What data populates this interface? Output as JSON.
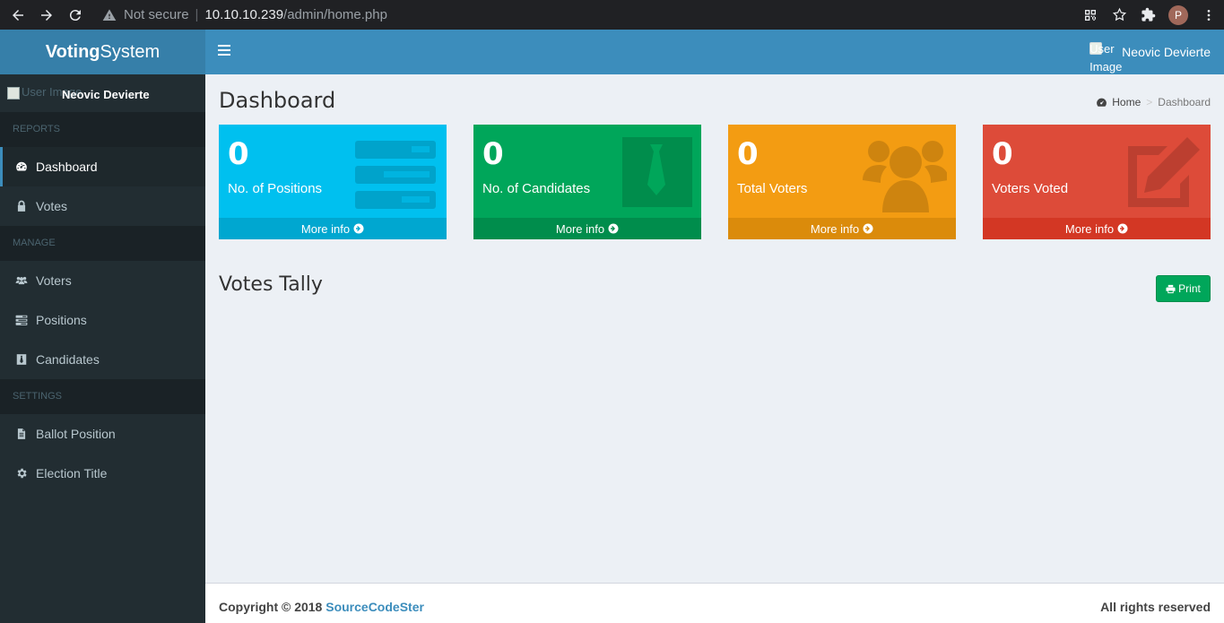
{
  "browser": {
    "not_secure": "Not secure",
    "url_host": "10.10.10.239",
    "url_path": "/admin/home.php",
    "profile_initial": "P"
  },
  "app": {
    "logo_bold": "Voting",
    "logo_rest": "System",
    "top_user_image_alt": "User Image",
    "top_user_name": "Neovic Devierte"
  },
  "sidebar": {
    "user_image_alt": "User Image",
    "user_name": "Neovic Devierte",
    "sections": [
      {
        "header": "REPORTS",
        "items": [
          {
            "label": "Dashboard",
            "icon": "dashboard-icon"
          },
          {
            "label": "Votes",
            "icon": "lock-icon"
          }
        ]
      },
      {
        "header": "MANAGE",
        "items": [
          {
            "label": "Voters",
            "icon": "users-icon"
          },
          {
            "label": "Positions",
            "icon": "tasks-icon"
          },
          {
            "label": "Candidates",
            "icon": "black-tie-icon"
          }
        ]
      },
      {
        "header": "SETTINGS",
        "items": [
          {
            "label": "Ballot Position",
            "icon": "file-text-icon"
          },
          {
            "label": "Election Title",
            "icon": "cog-icon"
          }
        ]
      }
    ]
  },
  "page": {
    "title": "Dashboard",
    "breadcrumb_home": "Home",
    "breadcrumb_current": "Dashboard"
  },
  "boxes": [
    {
      "value": "0",
      "label": "No. of Positions",
      "link": "More info",
      "color": "#00c0ef",
      "footer_color": "#00a7d0",
      "icon": "tasks-icon"
    },
    {
      "value": "0",
      "label": "No. of Candidates",
      "link": "More info",
      "color": "#00a65a",
      "footer_color": "#008d4c",
      "icon": "black-tie-icon"
    },
    {
      "value": "0",
      "label": "Total Voters",
      "link": "More info",
      "color": "#f39c12",
      "footer_color": "#db8b0b",
      "icon": "users-icon"
    },
    {
      "value": "0",
      "label": "Voters Voted",
      "link": "More info",
      "color": "#dd4b39",
      "footer_color": "#d33724",
      "icon": "edit-icon"
    }
  ],
  "tally": {
    "title": "Votes Tally",
    "print_label": "Print"
  },
  "footer": {
    "copyright": "Copyright © 2018 ",
    "link": "SourceCodeSter",
    "rights": "All rights reserved"
  }
}
